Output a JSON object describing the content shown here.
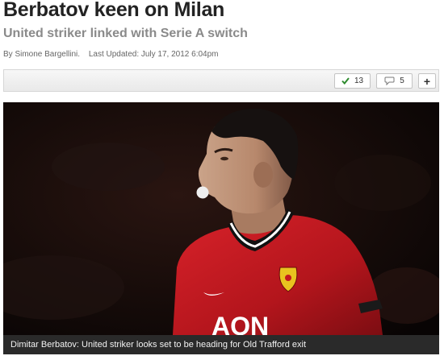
{
  "article": {
    "headline": "Berbatov keen on Milan",
    "subheadline": "United striker linked with Serie A switch",
    "byline": "By Simone Bargellini.",
    "last_updated": "Last Updated: July 17, 2012 6:04pm"
  },
  "toolbar": {
    "recommend_count": "13",
    "recommend_icon": "checkmark-icon",
    "comments_count": "5",
    "comments_icon": "speech-bubble-icon",
    "share_label": "+",
    "accent_color": "#2e8b2e"
  },
  "photo": {
    "kit_sponsor_text": "AON",
    "caption": "Dimitar Berbatov: United striker looks set to be heading for Old Trafford exit"
  }
}
